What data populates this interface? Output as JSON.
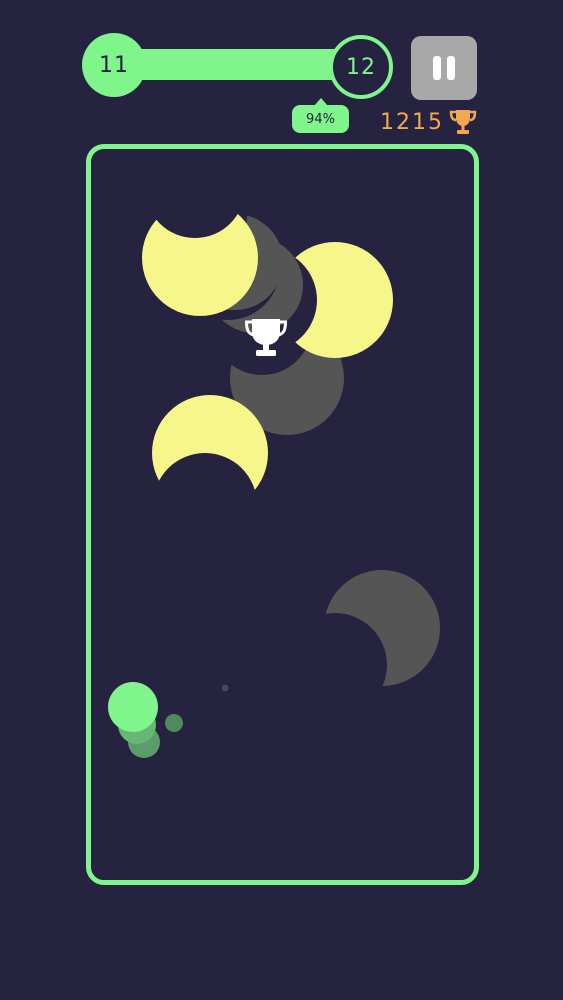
{
  "hud": {
    "level_current": "11",
    "level_next": "12",
    "progress_label": "94%",
    "progress_fraction": 0.94,
    "score": "1215",
    "pause_icon": "pause-icon",
    "score_icon": "trophy-icon"
  },
  "colors": {
    "background": "#25233f",
    "accent": "#7ff58c",
    "moon_active": "#f7f68a",
    "moon_inactive": "#555555",
    "score": "#f1a84f",
    "pause_button": "#a8a8a8"
  },
  "field": {
    "goal_icon": "trophy-icon",
    "player": "green-ball"
  }
}
